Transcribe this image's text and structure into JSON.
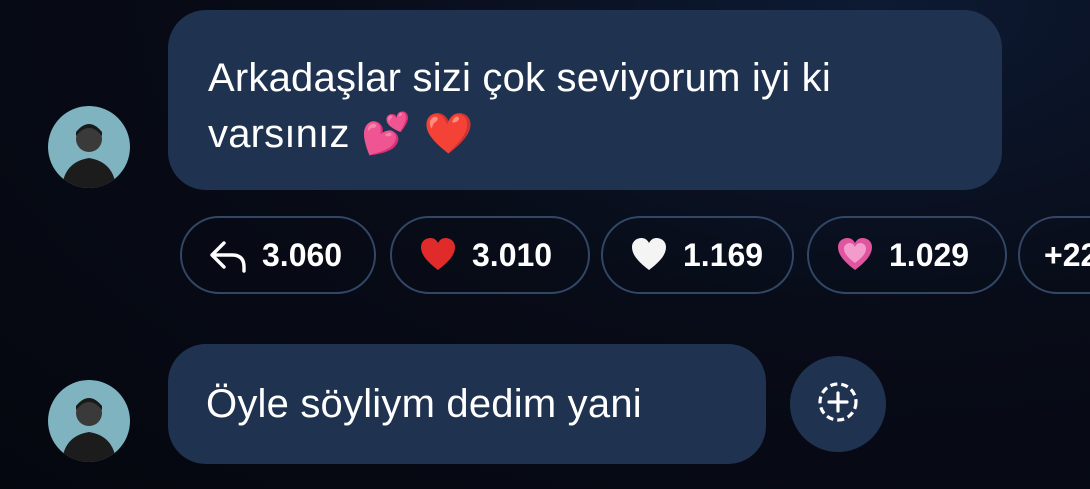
{
  "messages": [
    {
      "text": "Arkadaşlar sizi çok seviyorum iyi ki varsınız",
      "emojis": "💕 ❤️"
    },
    {
      "text": "Öyle söyliym dedim yani"
    }
  ],
  "reactions": [
    {
      "icon": "reply-arrow-icon",
      "count": "3.060"
    },
    {
      "icon": "red-heart-icon",
      "count": "3.010"
    },
    {
      "icon": "white-heart-icon",
      "count": "1.169"
    },
    {
      "icon": "pink-heart-icon",
      "count": "1.029"
    },
    {
      "icon": "",
      "count": "+22"
    }
  ],
  "colors": {
    "bubble": "#1f3250",
    "pill_border": "#324766",
    "background": "#080c18"
  }
}
